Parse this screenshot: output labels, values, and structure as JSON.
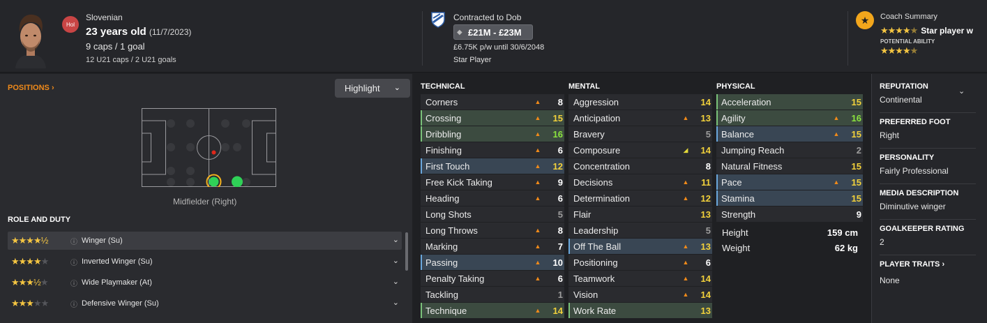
{
  "header": {
    "club_badge": "Hol",
    "nationality": "Slovenian",
    "age": "23 years old",
    "dob": "(11/7/2023)",
    "caps": "9 caps / 1 goal",
    "u21": "12 U21 caps / 2 U21 goals",
    "contract_label": "Contracted to Dob",
    "value": "£21M - £23M",
    "wage": "£6.75K p/w until 30/6/2048",
    "status": "Star Player",
    "coach_title": "Coach Summary",
    "coach_text": "Star player w",
    "potential_label": "POTENTIAL ABILITY",
    "current_stars": 4.5,
    "potential_stars": 4.5
  },
  "positions": {
    "label": "POSITIONS",
    "highlight": "Highlight",
    "caption": "Midfielder (Right)"
  },
  "roles": {
    "title": "ROLE AND DUTY",
    "items": [
      {
        "name": "Winger (Su)",
        "stars": "★★★★",
        "half": "½",
        "off": ""
      },
      {
        "name": "Inverted Winger (Su)",
        "stars": "★★★★",
        "half": "",
        "off": "★"
      },
      {
        "name": "Wide Playmaker (At)",
        "stars": "★★★",
        "half": "½",
        "off": "★"
      },
      {
        "name": "Defensive Winger (Su)",
        "stars": "★★★",
        "half": "",
        "off": "★★"
      }
    ]
  },
  "technical": {
    "title": "TECHNICAL",
    "rows": [
      {
        "label": "Corners",
        "value": "8"
      },
      {
        "label": "Crossing",
        "value": "15"
      },
      {
        "label": "Dribbling",
        "value": "16"
      },
      {
        "label": "Finishing",
        "value": "6"
      },
      {
        "label": "First Touch",
        "value": "12"
      },
      {
        "label": "Free Kick Taking",
        "value": "9"
      },
      {
        "label": "Heading",
        "value": "6"
      },
      {
        "label": "Long Shots",
        "value": "5"
      },
      {
        "label": "Long Throws",
        "value": "8"
      },
      {
        "label": "Marking",
        "value": "7"
      },
      {
        "label": "Passing",
        "value": "10"
      },
      {
        "label": "Penalty Taking",
        "value": "6"
      },
      {
        "label": "Tackling",
        "value": "1"
      },
      {
        "label": "Technique",
        "value": "14"
      }
    ]
  },
  "mental": {
    "title": "MENTAL",
    "rows": [
      {
        "label": "Aggression",
        "value": "14"
      },
      {
        "label": "Anticipation",
        "value": "13"
      },
      {
        "label": "Bravery",
        "value": "5"
      },
      {
        "label": "Composure",
        "value": "14"
      },
      {
        "label": "Concentration",
        "value": "8"
      },
      {
        "label": "Decisions",
        "value": "11"
      },
      {
        "label": "Determination",
        "value": "12"
      },
      {
        "label": "Flair",
        "value": "13"
      },
      {
        "label": "Leadership",
        "value": "5"
      },
      {
        "label": "Off The Ball",
        "value": "13"
      },
      {
        "label": "Positioning",
        "value": "6"
      },
      {
        "label": "Teamwork",
        "value": "14"
      },
      {
        "label": "Vision",
        "value": "14"
      },
      {
        "label": "Work Rate",
        "value": "13"
      }
    ]
  },
  "physical": {
    "title": "PHYSICAL",
    "rows": [
      {
        "label": "Acceleration",
        "value": "15"
      },
      {
        "label": "Agility",
        "value": "16"
      },
      {
        "label": "Balance",
        "value": "15"
      },
      {
        "label": "Jumping Reach",
        "value": "2"
      },
      {
        "label": "Natural Fitness",
        "value": "15"
      },
      {
        "label": "Pace",
        "value": "15"
      },
      {
        "label": "Stamina",
        "value": "15"
      },
      {
        "label": "Strength",
        "value": "9"
      }
    ],
    "height_label": "Height",
    "height": "159 cm",
    "weight_label": "Weight",
    "weight": "62 kg"
  },
  "info": {
    "reputation_label": "REPUTATION",
    "reputation": "Continental",
    "foot_label": "PREFERRED FOOT",
    "foot": "Right",
    "personality_label": "PERSONALITY",
    "personality": "Fairly Professional",
    "media_label": "MEDIA DESCRIPTION",
    "media": "Diminutive winger",
    "gk_label": "GOALKEEPER RATING",
    "gk": "2",
    "traits_label": "PLAYER TRAITS",
    "traits": "None"
  },
  "colors": {
    "accent": "#f08a1a",
    "green_value": "#8be33e",
    "yellow_value": "#f2d13b",
    "highlight_green": "#3c4b40",
    "highlight_blue": "#394654"
  }
}
